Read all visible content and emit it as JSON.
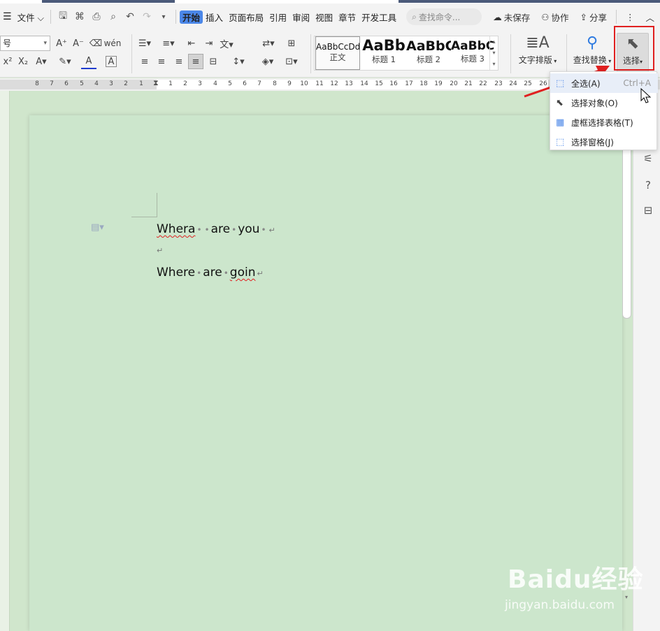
{
  "menubar": {
    "file_label": "文件",
    "tabs": [
      "开始",
      "插入",
      "页面布局",
      "引用",
      "审阅",
      "视图",
      "章节",
      "开发工具"
    ],
    "search_placeholder": "查找命令...",
    "unsaved_label": "未保存",
    "collab_label": "协作",
    "share_label": "分享"
  },
  "ribbon": {
    "font_size_value": "号",
    "styles": [
      {
        "preview": "AaBbCcDd",
        "label": "正文"
      },
      {
        "preview": "AaBb",
        "label": "标题 1"
      },
      {
        "preview": "AaBbC",
        "label": "标题 2"
      },
      {
        "preview": "AaBbCc",
        "label": "标题 3"
      }
    ],
    "text_layout_label": "文字排版",
    "find_replace_label": "查找替换",
    "select_label": "选择"
  },
  "ruler": {
    "left_numbers": [
      "8",
      "7",
      "6",
      "5",
      "4",
      "3",
      "2",
      "1"
    ],
    "right_numbers": [
      "1",
      "2",
      "3",
      "4",
      "5",
      "6",
      "7",
      "8",
      "9",
      "10",
      "11",
      "12",
      "13",
      "14",
      "15",
      "16",
      "17",
      "18",
      "19",
      "20",
      "21",
      "22",
      "23",
      "24",
      "25",
      "26"
    ]
  },
  "document": {
    "line1": {
      "w1": "Whera",
      "w2": "are",
      "w3": "you"
    },
    "line2": {
      "w1": "Where",
      "w2": "are",
      "w3": "goin"
    },
    "para_mark": "↵"
  },
  "select_menu": {
    "items": [
      {
        "label": "全选(A)",
        "shortcut": "Ctrl+A"
      },
      {
        "label": "选择对象(O)",
        "shortcut": ""
      },
      {
        "label": "虚框选择表格(T)",
        "shortcut": ""
      },
      {
        "label": "选择窗格(J)",
        "shortcut": ""
      }
    ]
  },
  "watermark": {
    "logo": "Baidu经验",
    "url": "jingyan.baidu.com"
  },
  "colors": {
    "accent": "#4b87e8",
    "highlight_red": "#e02020",
    "page_green": "#cce6cc"
  }
}
